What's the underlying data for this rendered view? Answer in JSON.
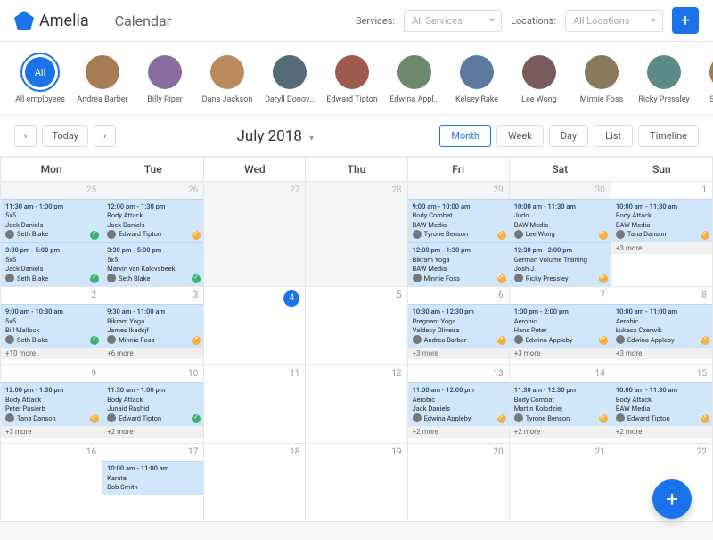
{
  "header": {
    "brand": "Amelia",
    "title": "Calendar",
    "services_label": "Services:",
    "services_placeholder": "All Services",
    "locations_label": "Locations:",
    "locations_placeholder": "All Locations"
  },
  "employees": [
    {
      "label": "All employees",
      "all": true
    },
    {
      "label": "Andrea Barber"
    },
    {
      "label": "Billy Piper"
    },
    {
      "label": "Dana Jackson"
    },
    {
      "label": "Daryll Donov…"
    },
    {
      "label": "Edward Tipton"
    },
    {
      "label": "Edwina Appl…"
    },
    {
      "label": "Kelsey Rake"
    },
    {
      "label": "Lee Wong"
    },
    {
      "label": "Minnie Foss"
    },
    {
      "label": "Ricky Pressley"
    },
    {
      "label": "Seth Blak"
    }
  ],
  "toolbar": {
    "today": "Today",
    "title": "July 2018",
    "views": [
      "Month",
      "Week",
      "Day",
      "List",
      "Timeline"
    ],
    "active_view": "Month"
  },
  "days": [
    "Mon",
    "Tue",
    "Wed",
    "Thu",
    "Fri",
    "Sat",
    "Sun"
  ],
  "all_label": "All",
  "weeks": [
    [
      {
        "num": "25",
        "oom": true,
        "events": [
          {
            "time": "11:30 am - 1:00 pm",
            "l1": "5x5",
            "l2": "Jack Daniels",
            "asg": "Seth Blake",
            "st": "ok"
          },
          {
            "time": "3:30 pm - 5:00 pm",
            "l1": "5x5",
            "l2": "Jack Daniels",
            "asg": "Seth Blake",
            "st": "ok"
          }
        ]
      },
      {
        "num": "26",
        "oom": true,
        "events": [
          {
            "time": "12:00 pm - 1:30 pm",
            "l1": "Body Attack",
            "l2": "Jack Daniels",
            "asg": "Edward Tipton",
            "st": "pending"
          },
          {
            "time": "3:30 pm - 5:00 pm",
            "l1": "5x5",
            "l2": "Marvin van Kalcvsbeek",
            "asg": "Seth Blake",
            "st": "ok"
          }
        ]
      },
      {
        "num": "27",
        "oom": true,
        "events": []
      },
      {
        "num": "28",
        "oom": true,
        "events": []
      },
      {
        "num": "29",
        "oom": true,
        "events": [
          {
            "time": "9:00 am - 10:00 am",
            "l1": "Body Combat",
            "l2": "BAW Media",
            "asg": "Tyrone Benson",
            "st": "pending"
          },
          {
            "time": "12:00 pm - 1:30 pm",
            "l1": "Bikram Yoga",
            "l2": "BAW Media",
            "asg": "Minnie Foss",
            "st": "pending"
          }
        ]
      },
      {
        "num": "30",
        "oom": true,
        "events": [
          {
            "time": "10:00 am - 11:30 am",
            "l1": "Judo",
            "l2": "BAW Media",
            "asg": "Lee Wong",
            "st": "pending"
          },
          {
            "time": "12:30 pm - 2:00 pm",
            "l1": "German Volume Training",
            "l2": "Josh J.",
            "asg": "Ricky Pressley",
            "st": "pending"
          }
        ]
      },
      {
        "num": "1",
        "events": [
          {
            "time": "10:00 am - 11:30 am",
            "l1": "Body Attack",
            "l2": "BAW Media",
            "asg": "Tana Danson",
            "st": "pending"
          }
        ],
        "more": "+3 more"
      }
    ],
    [
      {
        "num": "2",
        "events": [
          {
            "time": "9:00 am - 10:30 am",
            "l1": "5x5",
            "l2": "Bill Mallock",
            "asg": "Seth Blake",
            "st": "ok"
          }
        ],
        "more": "+10 more"
      },
      {
        "num": "3",
        "events": [
          {
            "time": "9:30 am - 11:00 am",
            "l1": "Bikram Yoga",
            "l2": "James Ikadsjf",
            "asg": "Minnie Foss",
            "st": "pending"
          }
        ],
        "more": "+6 more"
      },
      {
        "num": "4",
        "today": true,
        "events": []
      },
      {
        "num": "5",
        "events": []
      },
      {
        "num": "6",
        "events": [
          {
            "time": "10:30 am - 12:30 pm",
            "l1": "Pregnant Yoga",
            "l2": "Valdecy Oliveira",
            "asg": "Andrea Barber",
            "st": "pending"
          }
        ],
        "more": "+3 more"
      },
      {
        "num": "7",
        "events": [
          {
            "time": "1:00 pm - 2:00 pm",
            "l1": "Aerobic",
            "l2": "Hans Peter",
            "asg": "Edwina Appleby",
            "st": "pending"
          }
        ],
        "more": "+3 more"
      },
      {
        "num": "8",
        "events": [
          {
            "time": "10:00 am - 11:00 am",
            "l1": "Aerobic",
            "l2": "Łukasz Czerwik",
            "asg": "Edwina Appleby",
            "st": "pending"
          }
        ],
        "more": "+3 more"
      }
    ],
    [
      {
        "num": "9",
        "events": [
          {
            "time": "12:00 pm - 1:30 pm",
            "l1": "Body Attack",
            "l2": "Peter Pasierb",
            "asg": "Tana Danson",
            "st": "pending"
          }
        ],
        "more": "+3 more"
      },
      {
        "num": "10",
        "events": [
          {
            "time": "11:30 am - 1:00 pm",
            "l1": "Body Attack",
            "l2": "Junaid Rashid",
            "asg": "Edward Tipton",
            "st": "ok"
          }
        ],
        "more": "+2 more"
      },
      {
        "num": "11",
        "events": []
      },
      {
        "num": "12",
        "events": []
      },
      {
        "num": "13",
        "events": [
          {
            "time": "11:00 am - 12:00 pm",
            "l1": "Aerobic",
            "l2": "Jack Daniels",
            "asg": "Edwina Appleby",
            "st": "pending"
          }
        ],
        "more": "+2 more"
      },
      {
        "num": "14",
        "events": [
          {
            "time": "11:30 am - 12:30 pm",
            "l1": "Body Combat",
            "l2": "Martin Kolodziej",
            "asg": "Tyrone Benson",
            "st": "pending"
          }
        ],
        "more": "+2 more"
      },
      {
        "num": "15",
        "events": [
          {
            "time": "10:00 am - 11:30 am",
            "l1": "Body Attack",
            "l2": "BAW Media",
            "asg": "Edward Tipton",
            "st": "pending"
          }
        ],
        "more": "+2 more"
      }
    ],
    [
      {
        "num": "16",
        "events": []
      },
      {
        "num": "17",
        "events": [
          {
            "time": "10:00 am - 11:00 am",
            "l1": "Karate",
            "l2": "Bob Smith"
          }
        ]
      },
      {
        "num": "18",
        "events": []
      },
      {
        "num": "19",
        "events": []
      },
      {
        "num": "20",
        "events": []
      },
      {
        "num": "21",
        "events": []
      },
      {
        "num": "22",
        "events": []
      }
    ]
  ]
}
